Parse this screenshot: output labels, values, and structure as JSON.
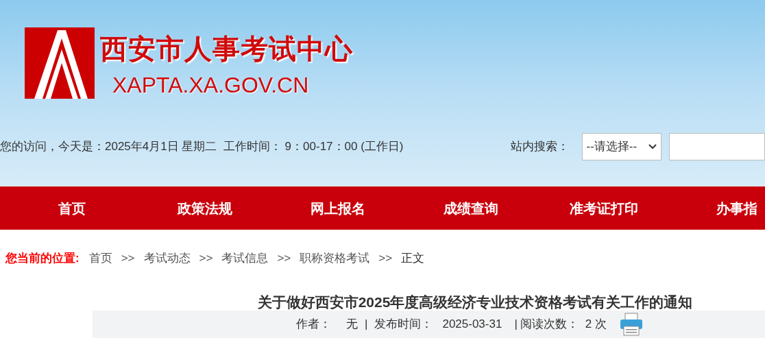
{
  "header": {
    "site_title": "西安市人事考试中心",
    "site_domain": "XAPTA.XA.GOV.CN",
    "visit_info": "您的访问，今天是：2025年4月1日 星期二  工作时间： 9：00-17：00 (工作日)",
    "search_label": "站内搜索：",
    "search_select": "--请选择--"
  },
  "nav": [
    {
      "label": "首页"
    },
    {
      "label": "政策法规"
    },
    {
      "label": "网上报名"
    },
    {
      "label": "成绩查询"
    },
    {
      "label": "准考证打印"
    },
    {
      "label": "办事指"
    }
  ],
  "breadcrumb": {
    "label": "您当前的位置:",
    "items": [
      "首页",
      "考试动态",
      "考试信息",
      "职称资格考试",
      "正文"
    ],
    "separator": ">>"
  },
  "article": {
    "title": "关于做好西安市2025年度高级经济专业技术资格考试有关工作的通知",
    "author_label": "作者：",
    "author": "无",
    "date_label": "发布时间：",
    "date": "2025-03-31",
    "reads_label": "阅读次数：",
    "reads": "2 次",
    "separator": "|"
  }
}
